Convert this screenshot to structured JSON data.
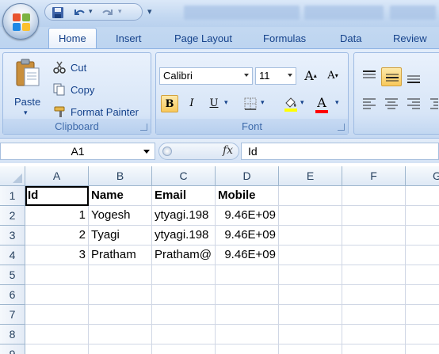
{
  "quick_access": {
    "save_icon": "save-icon",
    "undo_icon": "undo-icon",
    "redo_icon": "redo-icon",
    "customize_glyph": "▾"
  },
  "tabs": [
    {
      "label": "Home",
      "active": true
    },
    {
      "label": "Insert"
    },
    {
      "label": "Page Layout"
    },
    {
      "label": "Formulas"
    },
    {
      "label": "Data"
    },
    {
      "label": "Review"
    }
  ],
  "clipboard": {
    "paste_label": "Paste",
    "cut_label": "Cut",
    "copy_label": "Copy",
    "format_painter_label": "Format Painter",
    "group_label": "Clipboard"
  },
  "font": {
    "family": "Calibri",
    "size": "11",
    "bold": "B",
    "italic": "I",
    "underline": "U",
    "group_label": "Font",
    "grow_label": "A",
    "shrink_label": "A",
    "font_color_label": "A",
    "fill_color": "#ffff00",
    "font_color": "#ff0000"
  },
  "formula_bar": {
    "name_box": "A1",
    "fx_label": "fx",
    "content": "Id"
  },
  "sheet": {
    "columns": [
      "A",
      "B",
      "C",
      "D",
      "E",
      "F",
      "G"
    ],
    "rows": [
      "1",
      "2",
      "3",
      "4",
      "5",
      "6",
      "7",
      "8",
      "9"
    ],
    "cells": {
      "A1": "Id",
      "B1": "Name",
      "C1": "Email",
      "D1": "Mobile",
      "A2": "1",
      "B2": "Yogesh",
      "C2": "ytyagi.198",
      "D2": "9.46E+09",
      "A3": "2",
      "B3": "Tyagi",
      "C3": "ytyagi.198",
      "D3": "9.46E+09",
      "A4": "3",
      "B4": "Pratham",
      "C4": "Pratham@",
      "D4": "9.46E+09"
    }
  }
}
